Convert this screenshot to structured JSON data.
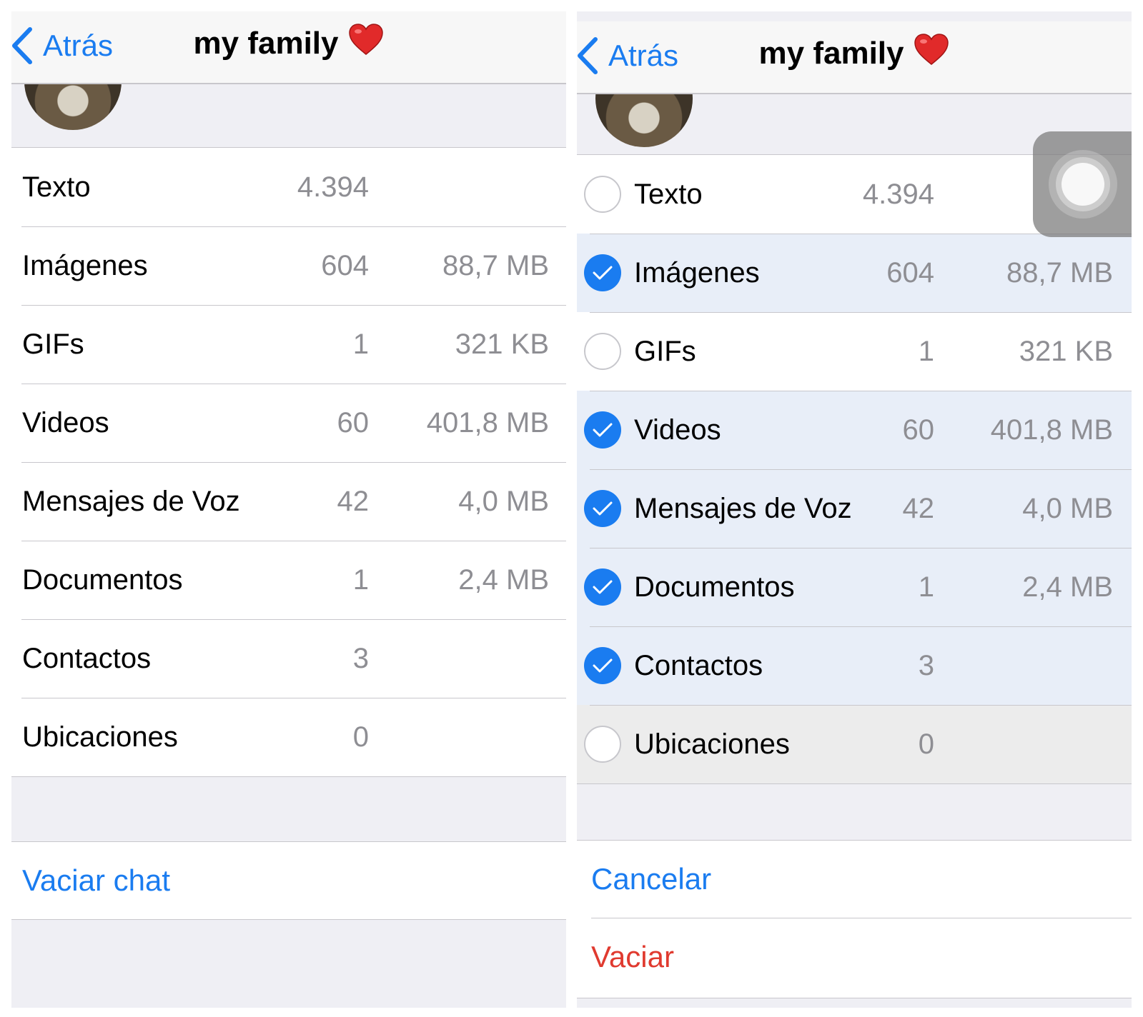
{
  "left": {
    "nav": {
      "back_label": "Atrás",
      "title": "my family"
    },
    "rows": [
      {
        "label": "Texto",
        "count": "4.394",
        "size": ""
      },
      {
        "label": "Imágenes",
        "count": "604",
        "size": "88,7 MB"
      },
      {
        "label": "GIFs",
        "count": "1",
        "size": "321 KB"
      },
      {
        "label": "Videos",
        "count": "60",
        "size": "401,8 MB"
      },
      {
        "label": "Mensajes de Voz",
        "count": "42",
        "size": "4,0 MB"
      },
      {
        "label": "Documentos",
        "count": "1",
        "size": "2,4 MB"
      },
      {
        "label": "Contactos",
        "count": "3",
        "size": ""
      },
      {
        "label": "Ubicaciones",
        "count": "0",
        "size": ""
      }
    ],
    "action": "Vaciar chat"
  },
  "right": {
    "nav": {
      "back_label": "Atrás",
      "title": "my family"
    },
    "rows": [
      {
        "label": "Texto",
        "count": "4.394",
        "size": "",
        "selected": false
      },
      {
        "label": "Imágenes",
        "count": "604",
        "size": "88,7 MB",
        "selected": true
      },
      {
        "label": "GIFs",
        "count": "1",
        "size": "321 KB",
        "selected": false
      },
      {
        "label": "Videos",
        "count": "60",
        "size": "401,8 MB",
        "selected": true
      },
      {
        "label": "Mensajes de Voz",
        "count": "42",
        "size": "4,0 MB",
        "selected": true
      },
      {
        "label": "Documentos",
        "count": "1",
        "size": "2,4 MB",
        "selected": true
      },
      {
        "label": "Contactos",
        "count": "3",
        "size": "",
        "selected": true
      },
      {
        "label": "Ubicaciones",
        "count": "0",
        "size": "",
        "selected": false
      }
    ],
    "cancel_label": "Cancelar",
    "clear_label": "Vaciar"
  },
  "colors": {
    "accent": "#1a7cf0",
    "destructive": "#e03a2f",
    "selected_row": "#e8eef8"
  }
}
